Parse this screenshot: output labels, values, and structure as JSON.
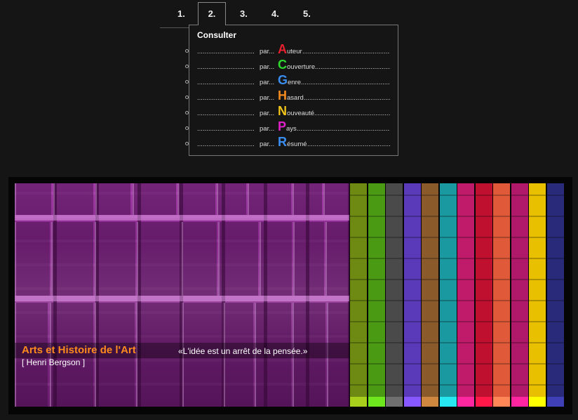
{
  "tabs": [
    {
      "label": "1."
    },
    {
      "label": "2."
    },
    {
      "label": "3."
    },
    {
      "label": "4."
    },
    {
      "label": "5."
    }
  ],
  "panel": {
    "title": "Consulter",
    "rows": [
      {
        "dots_left": "...............................",
        "par": "par...",
        "letter": "A",
        "word": "uteur",
        "color": "#e8202e",
        "dots_right": "..................................................."
      },
      {
        "dots_left": "...............................",
        "par": "par...",
        "letter": "C",
        "word": "ouverture",
        "color": "#2fd82f",
        "dots_right": "............................................"
      },
      {
        "dots_left": "...............................",
        "par": "par...",
        "letter": "G",
        "word": "enre",
        "color": "#3a8ef0",
        "dots_right": "....................................................."
      },
      {
        "dots_left": "...............................",
        "par": "par...",
        "letter": "H",
        "word": "asard",
        "color": "#f28a1e",
        "dots_right": "..................................................."
      },
      {
        "dots_left": "...............................",
        "par": "par...",
        "letter": "N",
        "word": "ouveauté",
        "color": "#f3c41a",
        "dots_right": "............................................."
      },
      {
        "dots_left": "...............................",
        "par": "par...",
        "letter": "P",
        "word": "ays",
        "color": "#e020c8",
        "dots_right": "........................................................"
      },
      {
        "dots_left": "...............................",
        "par": "par...",
        "letter": "R",
        "word": "ésumé",
        "color": "#3a8ef0",
        "dots_right": "................................................."
      }
    ]
  },
  "banner": {
    "title": "Arts et Histoire de l'Art",
    "quote": "«L'idée est un arrêt de la pensée.»",
    "author": "[ Henri Bergson ]",
    "title_color": "#ff8a1e",
    "strip_colors": [
      "#6f8a12",
      "#4a9a14",
      "#4a4a4a",
      "#5a3ab8",
      "#8a5a2a",
      "#1a9aa0",
      "#c01a6a",
      "#c01030",
      "#e05a3a",
      "#b0186a",
      "#e8c000",
      "#2a2a7a"
    ]
  }
}
